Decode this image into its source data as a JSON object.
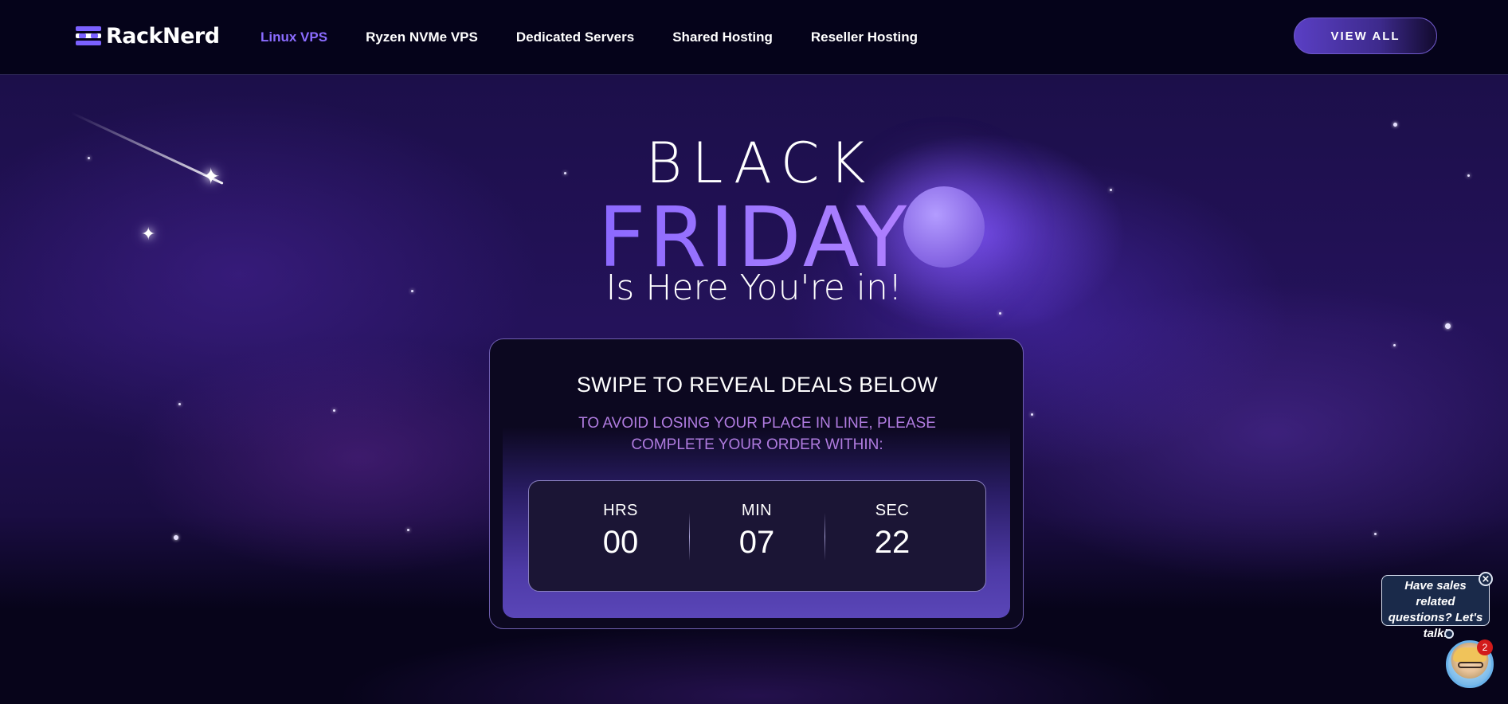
{
  "brand": {
    "name": "RackNerd"
  },
  "nav": {
    "links": [
      {
        "label": "Linux VPS",
        "active": true
      },
      {
        "label": "Ryzen NVMe VPS",
        "active": false
      },
      {
        "label": "Dedicated Servers",
        "active": false
      },
      {
        "label": "Shared Hosting",
        "active": false
      },
      {
        "label": "Reseller Hosting",
        "active": false
      }
    ],
    "cta_label": "VIEW ALL"
  },
  "hero": {
    "line1": "BLACK",
    "line2": "FRIDAY",
    "line3": "Is Here You're in!"
  },
  "countdown": {
    "heading": "SWIPE TO REVEAL DEALS BELOW",
    "note_line1": "TO AVOID LOSING YOUR PLACE IN LINE, PLEASE",
    "note_line2": "COMPLETE YOUR ORDER WITHIN:",
    "units": [
      {
        "label": "HRS",
        "value": "00"
      },
      {
        "label": "MIN",
        "value": "07"
      },
      {
        "label": "SEC",
        "value": "22"
      }
    ]
  },
  "chat": {
    "message_line1": "Have sales related",
    "message_line2": "questions? Let's",
    "message_line3": "talk!",
    "close_glyph": "×",
    "badge_count": "2"
  },
  "colors": {
    "accent": "#8b6cff",
    "nav_background": "#05031a",
    "card_note": "#b07ce0",
    "badge": "#d21b1b"
  },
  "icons": [
    "logo-mark-icon",
    "moon-icon",
    "shooting-star-icon",
    "sparkle-star-icon",
    "chat-close-icon",
    "chat-avatar-icon"
  ]
}
